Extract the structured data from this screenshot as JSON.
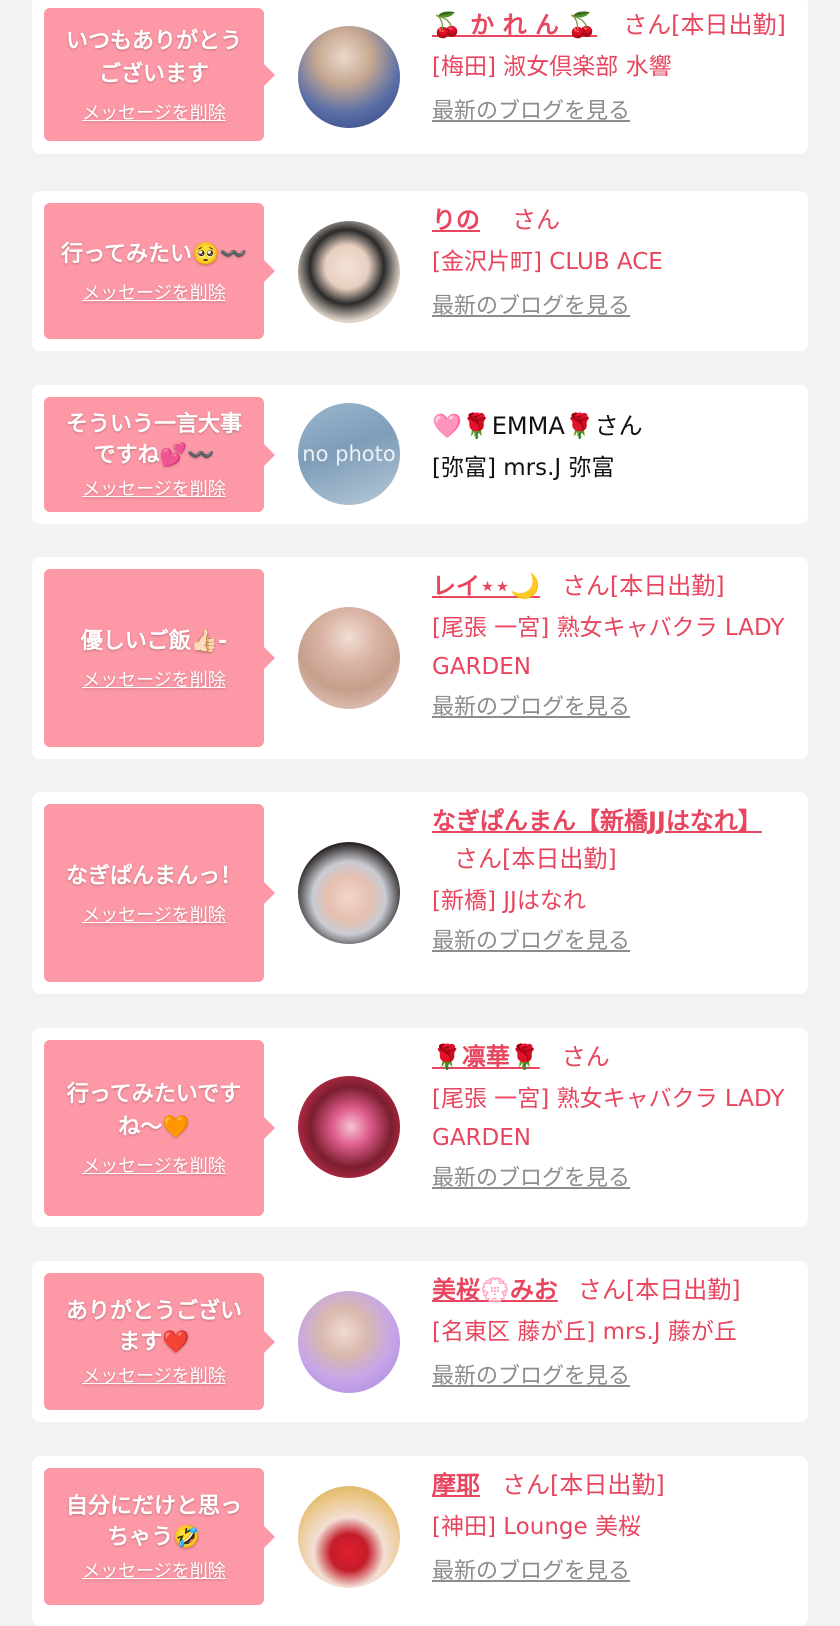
{
  "colors": {
    "pink": "#fd98a6",
    "accent": "#e8465f",
    "card": "#ffffff",
    "background": "#f2f2f2"
  },
  "entries": [
    {
      "message": "いつもありがとうございます",
      "delete_label": "メッセージを削除",
      "name": "🍒 か れ ん 🍒",
      "suffix": "さん[本日出勤]",
      "shop": "[梅田] 淑女倶楽部 水響",
      "blog": "最新のブログを見る"
    },
    {
      "message": "行ってみたい🥺〰️",
      "delete_label": "メッセージを削除",
      "name": "りの",
      "suffix": "さん",
      "shop": "[金沢片町] CLUB ACE",
      "blog": "最新のブログを見る"
    },
    {
      "message": "そういう一言大事ですね💕〰️",
      "delete_label": "メッセージを削除",
      "name": "🩷🌹EMMA🌹",
      "suffix": "さん",
      "shop": "[弥富] mrs.J 弥富",
      "avatar_text": "no photo"
    },
    {
      "message": "優しいご飯👍🏻-",
      "delete_label": "メッセージを削除",
      "name": "レイ⋆⋆🌙",
      "suffix": "さん[本日出勤]",
      "shop": "[尾張 一宮] 熟女キャバクラ LADY GARDEN",
      "blog": "最新のブログを見る"
    },
    {
      "message": "なぎぱんまんっ！",
      "delete_label": "メッセージを削除",
      "name": "なぎぱんまん【新橋JJはなれ】",
      "suffix": "さん[本日出勤]",
      "shop": "[新橋] JJはなれ",
      "blog": "最新のブログを見る"
    },
    {
      "message": "行ってみたいですね〜🧡",
      "delete_label": "メッセージを削除",
      "name": "🌹凛華🌹",
      "suffix": "さん",
      "shop": "[尾張 一宮] 熟女キャバクラ LADY GARDEN",
      "blog": "最新のブログを見る"
    },
    {
      "message": "ありがとうございます❤️",
      "delete_label": "メッセージを削除",
      "name": "美桜💮みお",
      "suffix": "さん[本日出勤]",
      "shop": "[名東区 藤が丘] mrs.J 藤が丘",
      "blog": "最新のブログを見る"
    },
    {
      "message": "自分にだけと思っちゃう🤣",
      "delete_label": "メッセージを削除",
      "name": "摩耶",
      "suffix": "さん[本日出勤]",
      "shop": "[神田] Lounge 美桜",
      "blog": "最新のブログを見る"
    }
  ]
}
